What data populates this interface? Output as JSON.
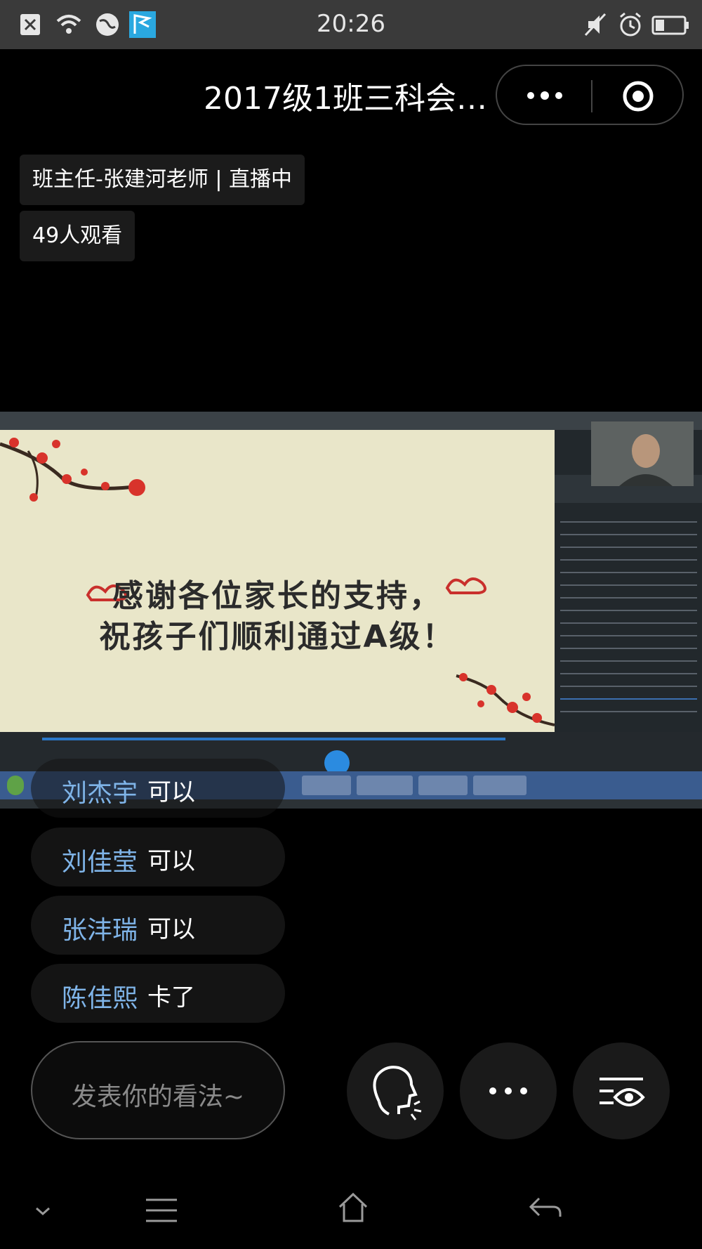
{
  "status_bar": {
    "time": "20:26",
    "left_icons": [
      "close-icon",
      "wifi-icon",
      "globe-icon",
      "flag-icon"
    ],
    "right_icons": [
      "mute-icon",
      "alarm-icon",
      "battery-icon"
    ]
  },
  "header": {
    "title": "2017级1班三科会…",
    "menu_icon": "more-dots-icon",
    "close_icon": "target-close-icon"
  },
  "live_info": {
    "teacher_status": "班主任-张建河老师 | 直播中",
    "viewers": "49人观看"
  },
  "video": {
    "slide_line1": "感谢各位家长的支持，",
    "slide_line2": "祝孩子们顺利通过A级！"
  },
  "chat": [
    {
      "name": "刘杰宇",
      "message": "可以"
    },
    {
      "name": "刘佳莹",
      "message": "可以"
    },
    {
      "name": "张沣瑞",
      "message": "可以"
    },
    {
      "name": "陈佳熙",
      "message": "卡了"
    }
  ],
  "input": {
    "placeholder": "发表你的看法~"
  },
  "actions": [
    "speak-icon",
    "more-icon",
    "view-icon"
  ],
  "nav": [
    "chevron-down-icon",
    "menu-icon",
    "home-icon",
    "back-icon"
  ]
}
